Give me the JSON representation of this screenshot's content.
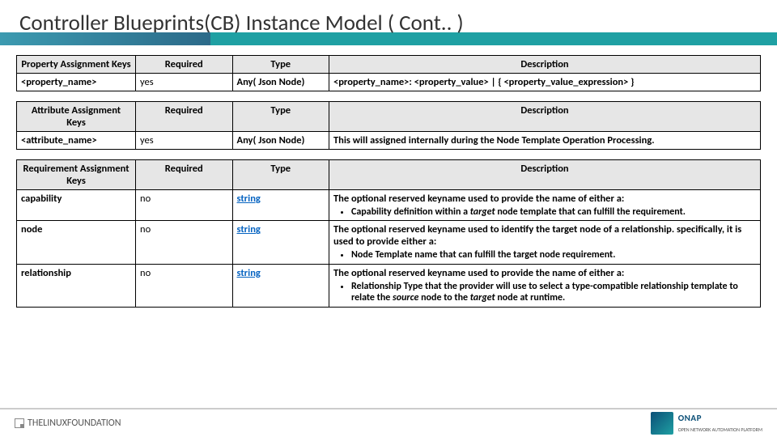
{
  "title": "Controller Blueprints(CB) Instance Model ( Cont.. )",
  "columns": {
    "c1": "Keys",
    "c2": "Required",
    "c3": "Type",
    "c4": "Description"
  },
  "tables": [
    {
      "header_key": "Property Assignment Keys",
      "rows": [
        {
          "k": "<property_name>",
          "req": "yes",
          "type": "Any( Json Node)",
          "type_link": false,
          "desc": "<property_name>: <property_value> | { <property_value_expression> }"
        }
      ]
    },
    {
      "header_key": "Attribute Assignment Keys",
      "rows": [
        {
          "k": "<attribute_name>",
          "req": "yes",
          "type": "Any( Json Node)",
          "type_link": false,
          "desc": "This will assigned internally during the Node Template Operation Processing."
        }
      ]
    },
    {
      "header_key": "Requirement Assignment Keys",
      "rows": [
        {
          "k": "capability",
          "req": "no",
          "type": "string",
          "type_link": true,
          "desc": "The optional reserved keyname used to provide the name of either a:",
          "bullets": [
            "Capability definition within a <i>target</i> node template that can fulfill the requirement."
          ]
        },
        {
          "k": "node",
          "req": "no",
          "type": "string",
          "type_link": true,
          "desc": "The optional reserved keyname used to identify the target node of a relationship. specifically, it is used to provide either a:",
          "bullets": [
            "Node Template name that can fulfill the target node requirement."
          ]
        },
        {
          "k": "relationship",
          "req": "no",
          "type": "string",
          "type_link": true,
          "desc": "The optional reserved keyname used to provide the name of either a:",
          "bullets": [
            "Relationship Type that the provider will use to select a type-compatible relationship template to relate the <i>source</i> node to the <i>target</i> node at runtime."
          ]
        }
      ]
    }
  ],
  "footer": {
    "left_brand": "THELINUXFOUNDATION",
    "right_brand": "ONAP",
    "right_sub": "OPEN NETWORK AUTOMATION PLATFORM"
  }
}
